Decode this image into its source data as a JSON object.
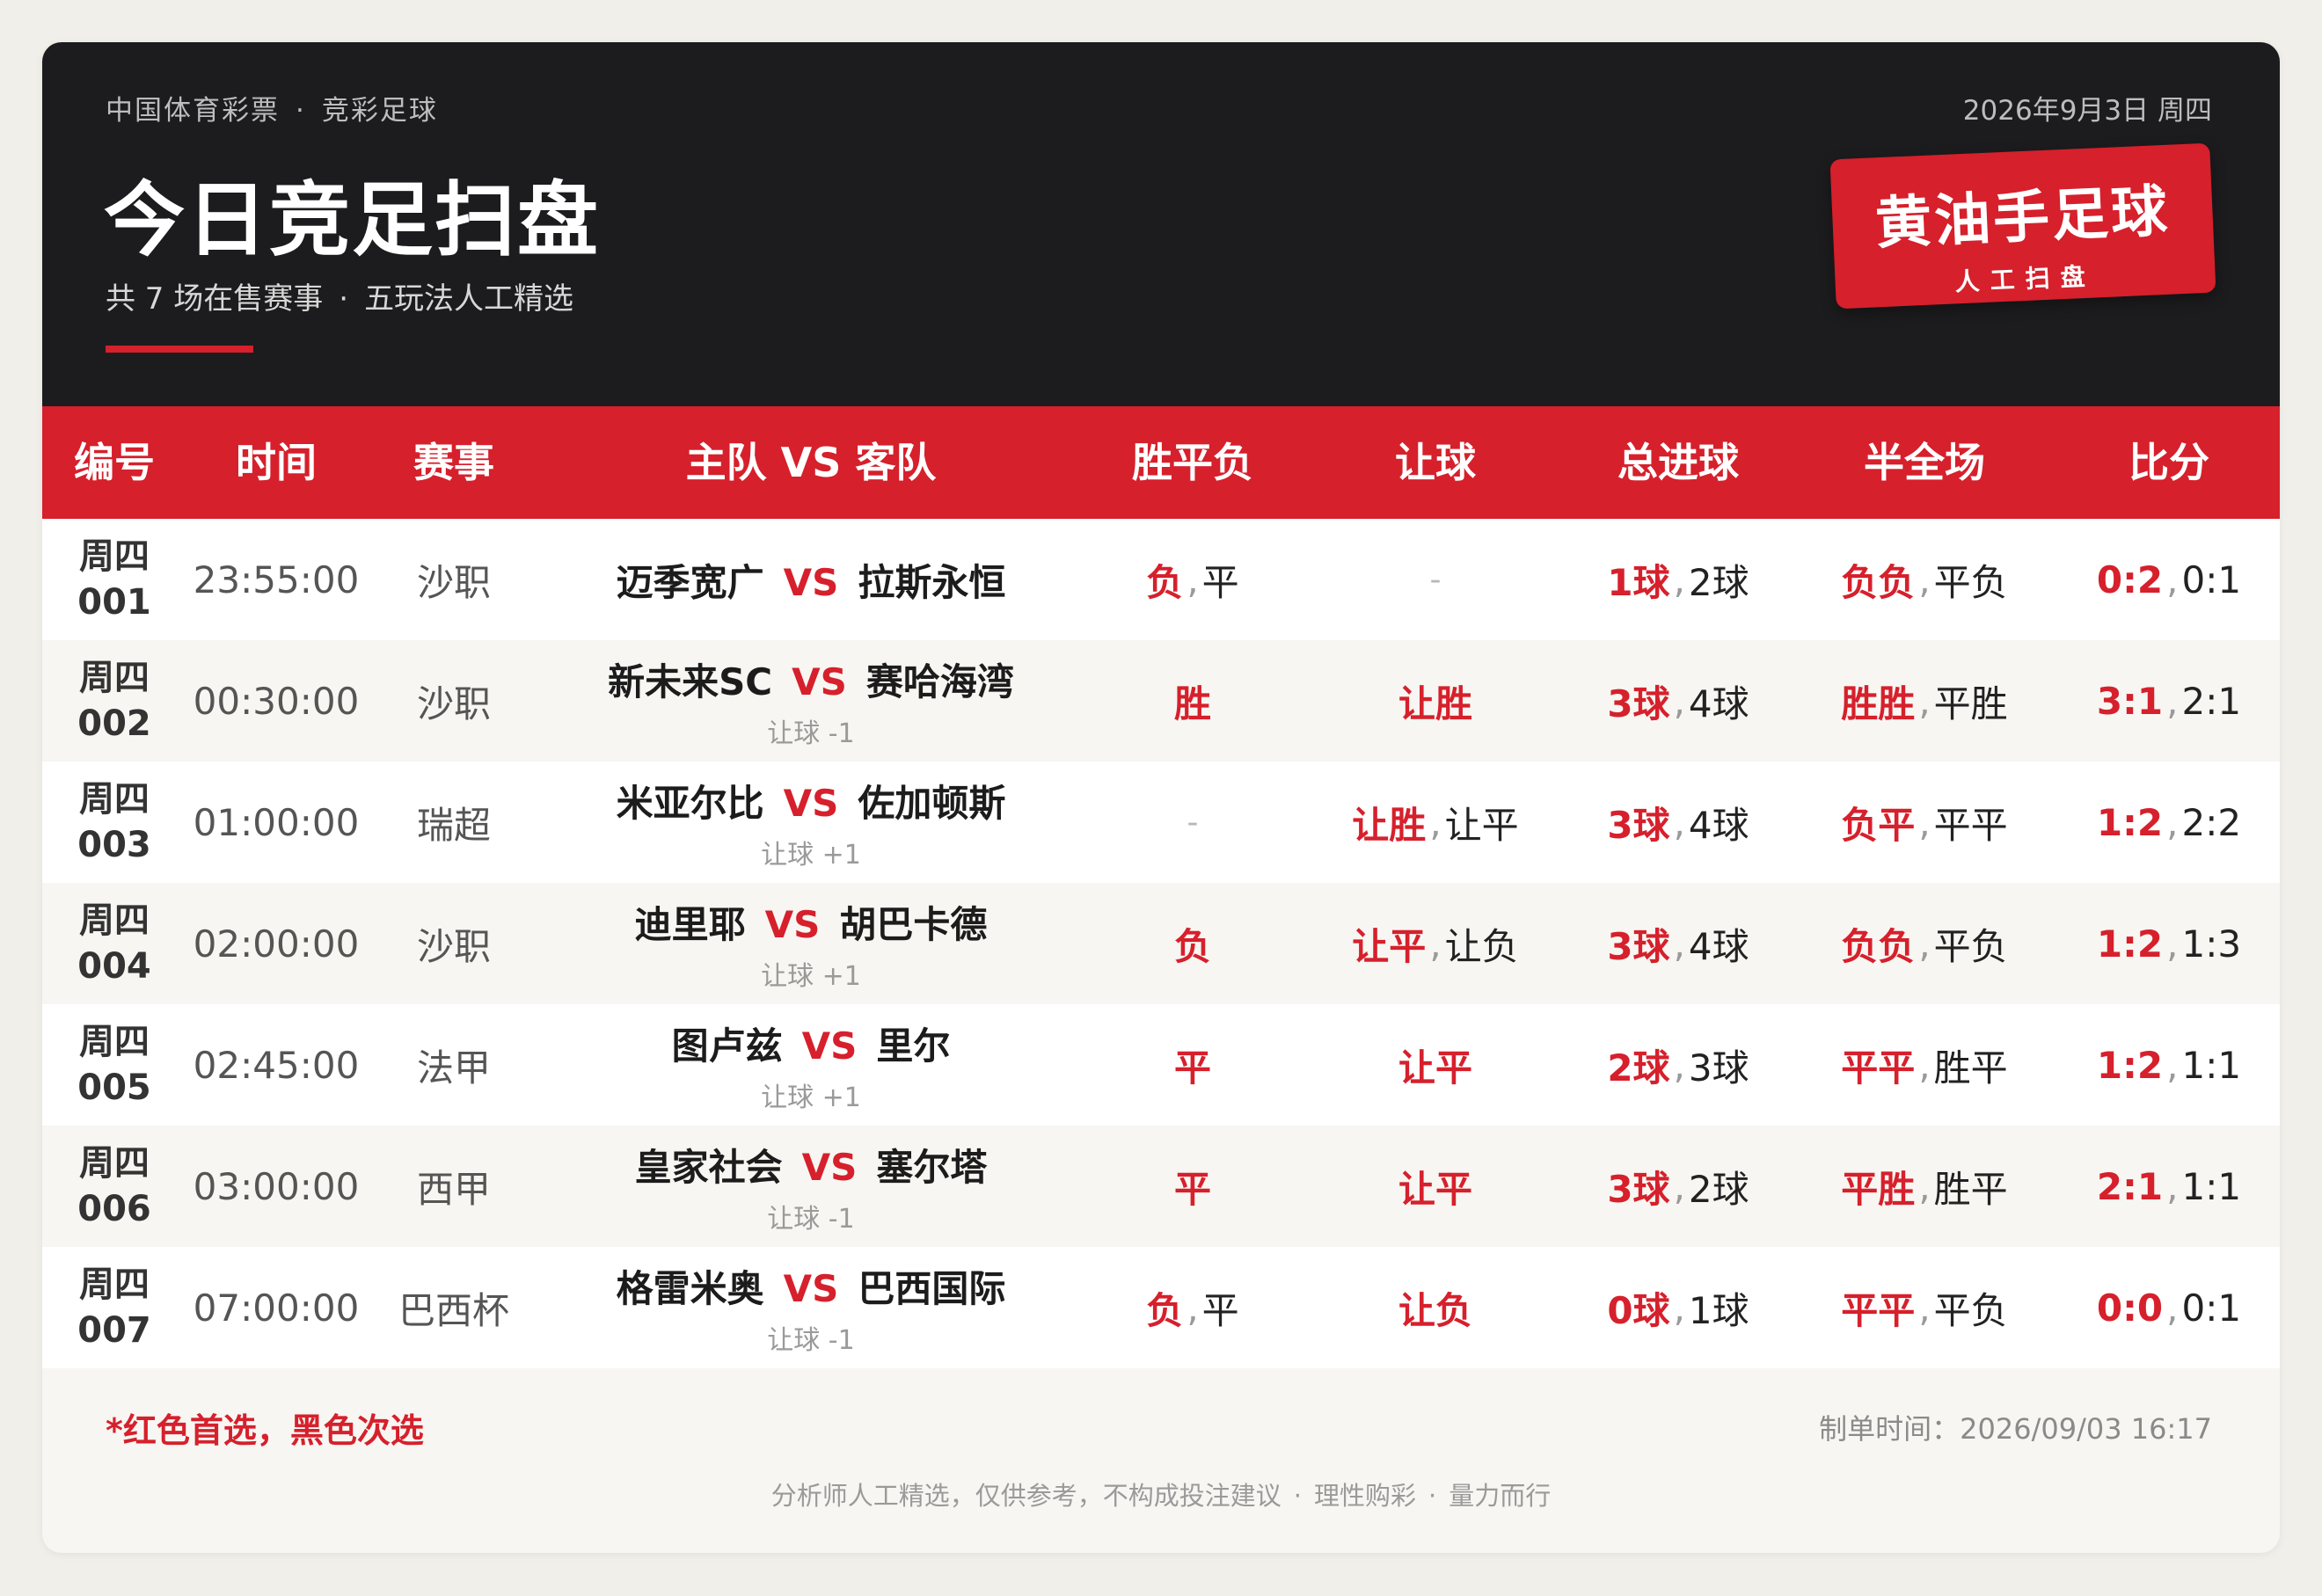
{
  "header": {
    "kicker_left": "中国体育彩票",
    "kicker_sep": "·",
    "kicker_right": "竞彩足球",
    "date": "2026年9月3日 周四",
    "title": "今日竞足扫盘",
    "subtitle_left": "共 7 场在售赛事",
    "subtitle_sep": "·",
    "subtitle_right": "五玩法人工精选",
    "badge_main": "黄油手足球",
    "badge_sub": "人工扫盘"
  },
  "columns": [
    "编号",
    "时间",
    "赛事",
    "主队 VS 客队",
    "胜平负",
    "让球",
    "总进球",
    "半全场",
    "比分"
  ],
  "vs_label": "VS",
  "pick_sep": ",",
  "rows": [
    {
      "day": "周四",
      "no": "001",
      "time": "23:55:00",
      "league": "沙职",
      "home": "迈季宽广",
      "away": "拉斯永恒",
      "handicap": "",
      "wdl": {
        "first": "负",
        "second": "平"
      },
      "hcp": {
        "first": "",
        "second": "",
        "empty": "-"
      },
      "goals": {
        "first": "1球",
        "second": "2球"
      },
      "htft": {
        "first": "负负",
        "second": "平负"
      },
      "score": {
        "first": "0:2",
        "second": "0:1"
      }
    },
    {
      "day": "周四",
      "no": "002",
      "time": "00:30:00",
      "league": "沙职",
      "home": "新未来SC",
      "away": "赛哈海湾",
      "handicap": "让球 -1",
      "wdl": {
        "first": "胜",
        "second": ""
      },
      "hcp": {
        "first": "让胜",
        "second": ""
      },
      "goals": {
        "first": "3球",
        "second": "4球"
      },
      "htft": {
        "first": "胜胜",
        "second": "平胜"
      },
      "score": {
        "first": "3:1",
        "second": "2:1"
      }
    },
    {
      "day": "周四",
      "no": "003",
      "time": "01:00:00",
      "league": "瑞超",
      "home": "米亚尔比",
      "away": "佐加顿斯",
      "handicap": "让球 +1",
      "wdl": {
        "first": "",
        "second": "",
        "empty": "-"
      },
      "hcp": {
        "first": "让胜",
        "second": "让平"
      },
      "goals": {
        "first": "3球",
        "second": "4球"
      },
      "htft": {
        "first": "负平",
        "second": "平平"
      },
      "score": {
        "first": "1:2",
        "second": "2:2"
      }
    },
    {
      "day": "周四",
      "no": "004",
      "time": "02:00:00",
      "league": "沙职",
      "home": "迪里耶",
      "away": "胡巴卡德",
      "handicap": "让球 +1",
      "wdl": {
        "first": "负",
        "second": ""
      },
      "hcp": {
        "first": "让平",
        "second": "让负"
      },
      "goals": {
        "first": "3球",
        "second": "4球"
      },
      "htft": {
        "first": "负负",
        "second": "平负"
      },
      "score": {
        "first": "1:2",
        "second": "1:3"
      }
    },
    {
      "day": "周四",
      "no": "005",
      "time": "02:45:00",
      "league": "法甲",
      "home": "图卢兹",
      "away": "里尔",
      "handicap": "让球 +1",
      "wdl": {
        "first": "平",
        "second": ""
      },
      "hcp": {
        "first": "让平",
        "second": ""
      },
      "goals": {
        "first": "2球",
        "second": "3球"
      },
      "htft": {
        "first": "平平",
        "second": "胜平"
      },
      "score": {
        "first": "1:2",
        "second": "1:1"
      }
    },
    {
      "day": "周四",
      "no": "006",
      "time": "03:00:00",
      "league": "西甲",
      "home": "皇家社会",
      "away": "塞尔塔",
      "handicap": "让球 -1",
      "wdl": {
        "first": "平",
        "second": ""
      },
      "hcp": {
        "first": "让平",
        "second": ""
      },
      "goals": {
        "first": "3球",
        "second": "2球"
      },
      "htft": {
        "first": "平胜",
        "second": "胜平"
      },
      "score": {
        "first": "2:1",
        "second": "1:1"
      }
    },
    {
      "day": "周四",
      "no": "007",
      "time": "07:00:00",
      "league": "巴西杯",
      "home": "格雷米奥",
      "away": "巴西国际",
      "handicap": "让球 -1",
      "wdl": {
        "first": "负",
        "second": "平"
      },
      "hcp": {
        "first": "让负",
        "second": ""
      },
      "goals": {
        "first": "0球",
        "second": "1球"
      },
      "htft": {
        "first": "平平",
        "second": "平负"
      },
      "score": {
        "first": "0:0",
        "second": "0:1"
      }
    }
  ],
  "footer": {
    "note": "*红色首选，黑色次选",
    "made_time": "制单时间：2026/09/03 16:17",
    "disclaimer_1": "分析师人工精选，仅供参考，不构成投注建议",
    "disclaimer_sep": "·",
    "disclaimer_2": "理性购彩",
    "disclaimer_3": "量力而行"
  },
  "colors": {
    "accent": "#d6202c",
    "header_bg": "#1c1c1e",
    "row_alt": "#f7f6f2"
  }
}
